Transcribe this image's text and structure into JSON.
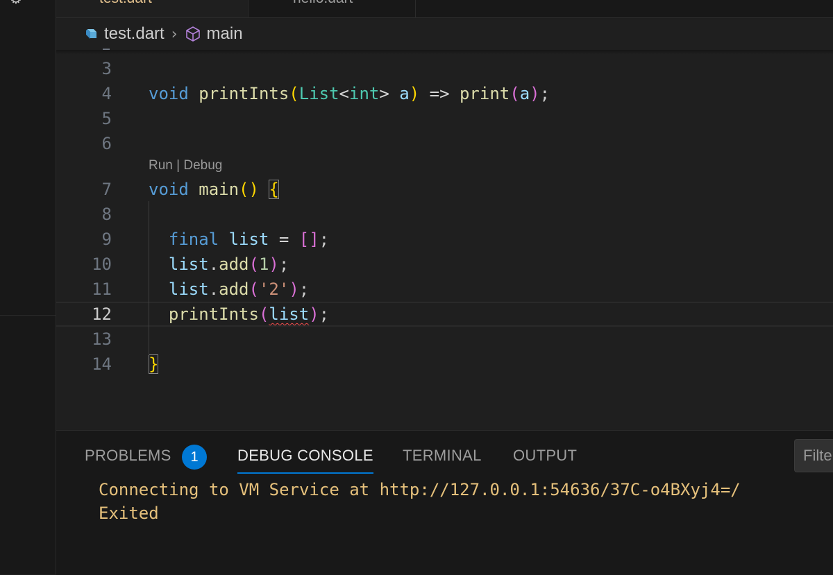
{
  "tabs": [
    {
      "label": "test.dart",
      "modified_marker": "1"
    },
    {
      "label": "hello.dart"
    }
  ],
  "breadcrumb": {
    "file": "test.dart",
    "symbol": "main"
  },
  "editor": {
    "codelens": {
      "run": "Run",
      "separator": " | ",
      "debug": "Debug"
    },
    "lines": [
      {
        "number": "3"
      },
      {
        "number": "4"
      },
      {
        "number": "5"
      },
      {
        "number": "6"
      },
      {
        "number": "7"
      },
      {
        "number": "8"
      },
      {
        "number": "9"
      },
      {
        "number": "10"
      },
      {
        "number": "11"
      },
      {
        "number": "12"
      },
      {
        "number": "13"
      },
      {
        "number": "14"
      }
    ],
    "active_line": "12"
  },
  "panel": {
    "tabs": {
      "problems": "PROBLEMS",
      "debug_console": "DEBUG CONSOLE",
      "terminal": "TERMINAL",
      "output": "OUTPUT"
    },
    "problems_count": "1",
    "filter_placeholder": "Filter",
    "console_lines": [
      "Connecting to VM Service at http://127.0.0.1:54636/37C-o4BXyj4=/",
      "Exited"
    ]
  },
  "colors": {
    "accent": "#0078d4",
    "console_text": "#e5c07b",
    "error_squiggle": "#f14c4c"
  },
  "icons": [
    "gear-icon",
    "dart-file-icon",
    "chevron-right-icon",
    "symbol-method-icon"
  ]
}
